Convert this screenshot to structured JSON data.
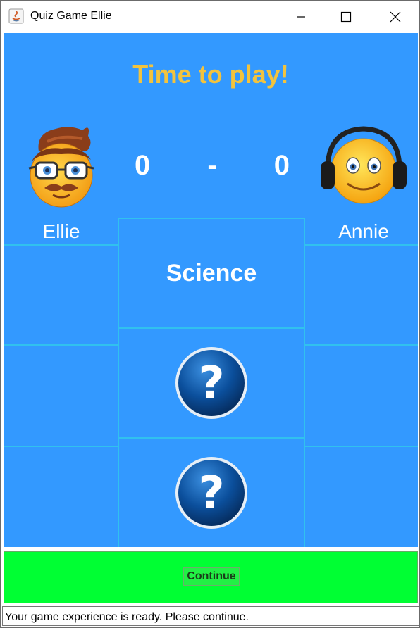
{
  "window": {
    "title": "Quiz Game Ellie"
  },
  "header": {
    "heading": "Time to play!"
  },
  "scoreboard": {
    "left_score": "0",
    "separator": "-",
    "right_score": "0"
  },
  "players": {
    "left_name": "Ellie",
    "right_name": "Annie"
  },
  "board": {
    "category": "Science",
    "hidden_question_icons": [
      "question-icon",
      "question-icon"
    ]
  },
  "footer": {
    "continue_label": "Continue",
    "status": "Your game experience is ready. Please continue."
  },
  "colors": {
    "background": "#3399ff",
    "heading": "#f2c33e",
    "grid_lines": "#31c1ee",
    "continue_panel": "#00ff33"
  }
}
